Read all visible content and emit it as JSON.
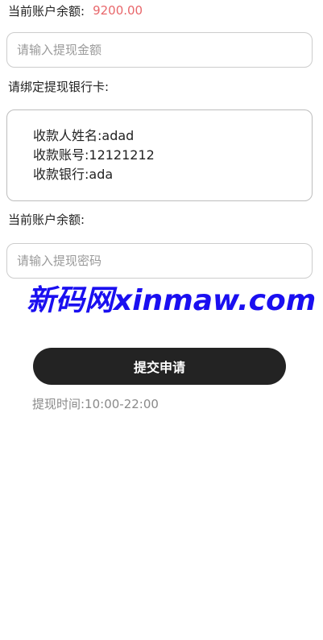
{
  "balance": {
    "label": "当前账户余额:",
    "amount": "9200.00",
    "amount_color": "#e8676b"
  },
  "amount_field": {
    "placeholder": "请输入提现金额",
    "value": ""
  },
  "bind_card_label": "请绑定提现银行卡:",
  "bank_card": {
    "name_line": "收款人姓名:adad",
    "account_line": "收款账号:12121212",
    "bank_line": "收款银行:ada"
  },
  "balance_label_2": "当前账户余额:",
  "password_field": {
    "placeholder": "请输入提现密码",
    "value": ""
  },
  "watermark": "新码网xinmaw.com",
  "submit_label": "提交申请",
  "time_note": "提现时间:10:00-22:00",
  "colors": {
    "button_bg": "#232323",
    "watermark": "#1a0ff0"
  }
}
